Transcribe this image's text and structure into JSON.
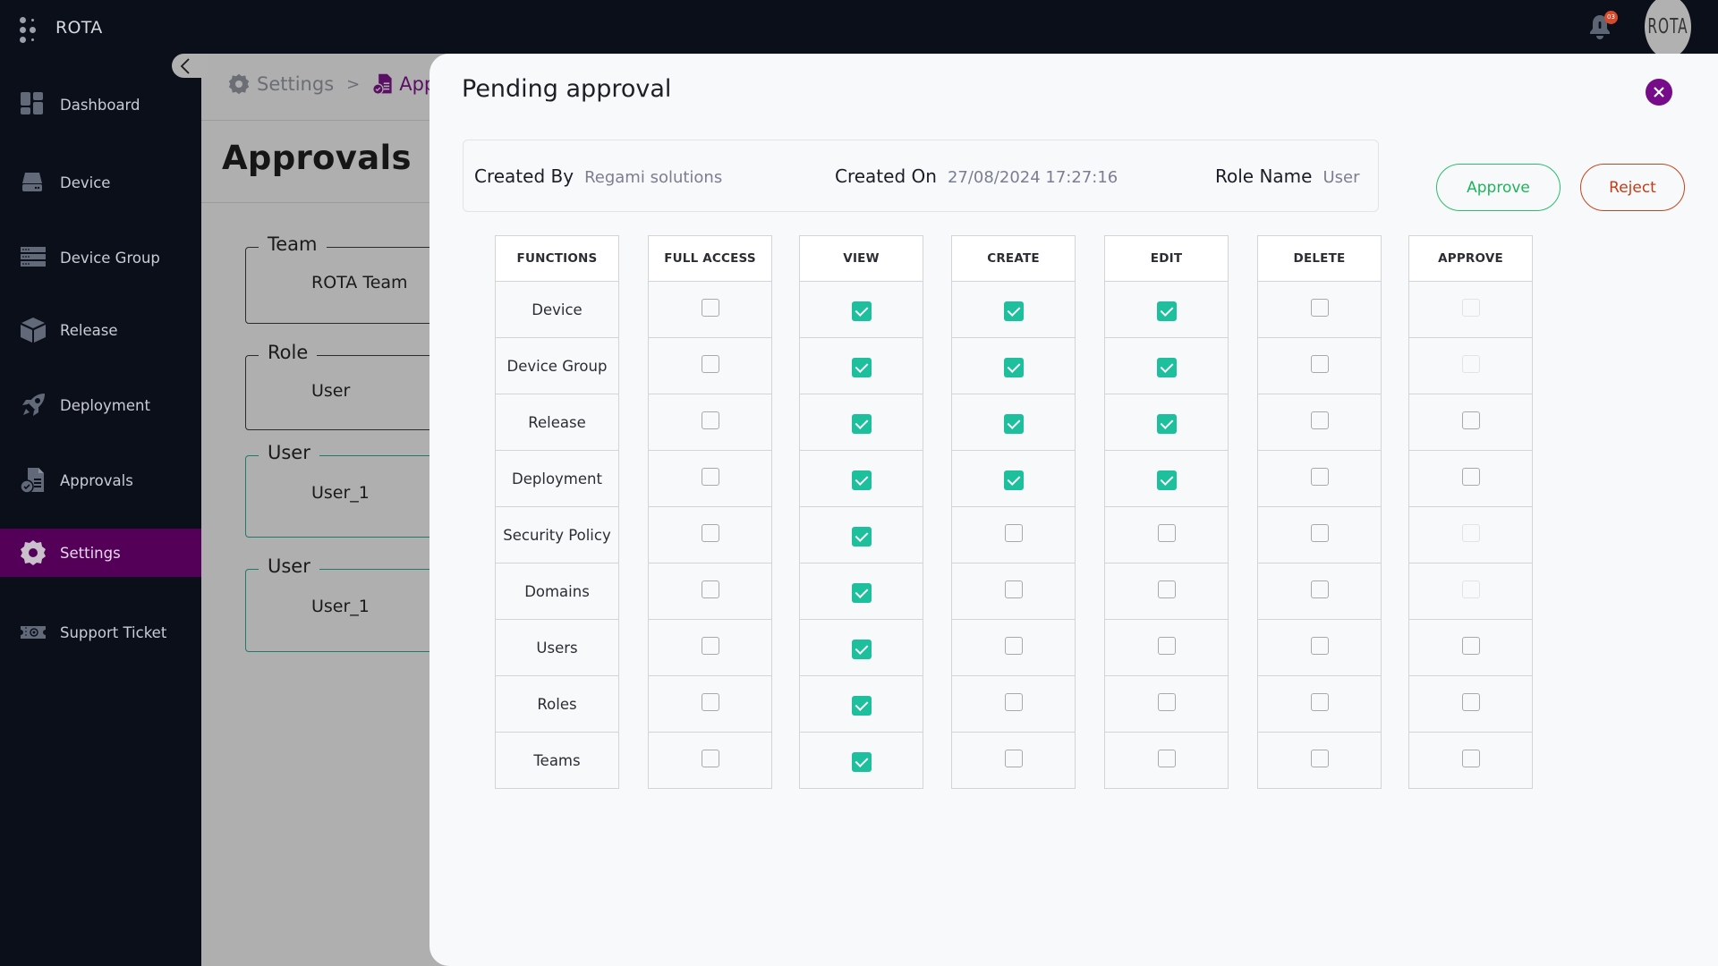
{
  "app": {
    "title": "ROTA",
    "notification_count": "03",
    "avatar_text": "ROTA"
  },
  "sidebar": {
    "items": [
      {
        "label": "Dashboard",
        "icon": "dashboard-icon",
        "active": false
      },
      {
        "label": "Device",
        "icon": "device-icon",
        "active": false
      },
      {
        "label": "Device Group",
        "icon": "device-group-icon",
        "active": false
      },
      {
        "label": "Release",
        "icon": "release-box-icon",
        "active": false
      },
      {
        "label": "Deployment",
        "icon": "rocket-icon",
        "active": false
      },
      {
        "label": "Approvals",
        "icon": "approvals-document-icon",
        "active": false
      },
      {
        "label": "Settings",
        "icon": "gear-icon",
        "active": true
      },
      {
        "label": "Support Ticket",
        "icon": "ticket-icon",
        "active": false
      }
    ]
  },
  "background_page": {
    "breadcrumb": {
      "parent": "Settings",
      "separator": ">",
      "current": "Appr"
    },
    "title": "Approvals",
    "fields": [
      {
        "legend": "Team",
        "value": "ROTA Team"
      },
      {
        "legend": "Role",
        "value": "User"
      },
      {
        "legend": "User",
        "value": "User_1"
      },
      {
        "legend": "User",
        "value": "User_1"
      }
    ]
  },
  "modal": {
    "title": "Pending approval",
    "info": {
      "created_by_label": "Created By",
      "created_by": "Regami solutions",
      "created_on_label": "Created On",
      "created_on": "27/08/2024 17:27:16",
      "role_name_label": "Role Name",
      "role_name": "User"
    },
    "approve_label": "Approve",
    "reject_label": "Reject",
    "colors": {
      "approve": "#1fb35d",
      "reject": "#c43d16",
      "checked": "#1dbf9c",
      "close": "#760c8a"
    },
    "permissions": {
      "columns": [
        "FUNCTIONS",
        "FULL ACCESS",
        "VIEW",
        "CREATE",
        "EDIT",
        "DELETE",
        "APPROVE"
      ],
      "rows": [
        {
          "function": "Device",
          "full_access": false,
          "view": true,
          "create": true,
          "edit": true,
          "delete": false,
          "approve": "disabled"
        },
        {
          "function": "Device Group",
          "full_access": false,
          "view": true,
          "create": true,
          "edit": true,
          "delete": false,
          "approve": "disabled"
        },
        {
          "function": "Release",
          "full_access": false,
          "view": true,
          "create": true,
          "edit": true,
          "delete": false,
          "approve": false
        },
        {
          "function": "Deployment",
          "full_access": false,
          "view": true,
          "create": true,
          "edit": true,
          "delete": false,
          "approve": false
        },
        {
          "function": "Security Policy",
          "full_access": false,
          "view": true,
          "create": false,
          "edit": false,
          "delete": false,
          "approve": "disabled"
        },
        {
          "function": "Domains",
          "full_access": false,
          "view": true,
          "create": false,
          "edit": false,
          "delete": false,
          "approve": "disabled"
        },
        {
          "function": "Users",
          "full_access": false,
          "view": true,
          "create": false,
          "edit": false,
          "delete": false,
          "approve": false
        },
        {
          "function": "Roles",
          "full_access": false,
          "view": true,
          "create": false,
          "edit": false,
          "delete": false,
          "approve": false
        },
        {
          "function": "Teams",
          "full_access": false,
          "view": true,
          "create": false,
          "edit": false,
          "delete": false,
          "approve": false
        }
      ]
    }
  }
}
